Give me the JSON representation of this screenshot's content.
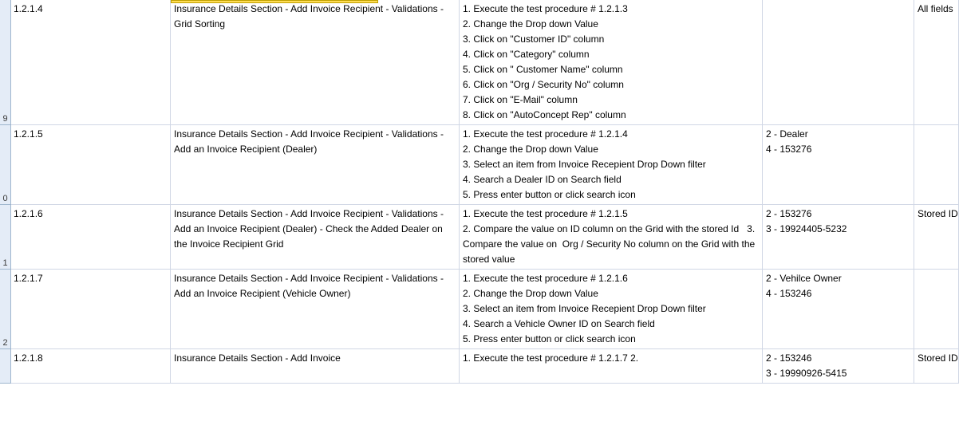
{
  "row_headers": [
    "9",
    "0",
    "1",
    "2",
    ""
  ],
  "rows": [
    {
      "id": "1.2.1.4",
      "title": "Insurance Details Section - Add Invoice Recipient - Validations - Grid Sorting",
      "steps": "1. Execute the test procedure # 1.2.1.3\n2. Change the Drop down Value\n3. Click on \"Customer ID\" column\n4. Click on \"Category\" column\n5. Click on \" Customer Name\" column\n6. Click on \"Org / Security No\" column\n7. Click on \"E-Mail\" column\n8. Click on \"AutoConcept Rep\" column",
      "data": "",
      "note": "All fields"
    },
    {
      "id": "1.2.1.5",
      "title": "Insurance Details Section - Add Invoice Recipient - Validations - Add an Invoice Recipient (Dealer)",
      "steps": "1. Execute the test procedure # 1.2.1.4\n2. Change the Drop down Value\n3. Select an item from Invoice Recepient Drop Down filter\n4. Search a Dealer ID on Search field\n5. Press enter button or click search icon",
      "data": "2 - Dealer\n4 - 153276",
      "note": ""
    },
    {
      "id": "1.2.1.6",
      "title": "Insurance Details Section - Add Invoice Recipient - Validations - Add an Invoice Recipient (Dealer) - Check the Added Dealer on the Invoice Recipient Grid",
      "steps": "1. Execute the test procedure # 1.2.1.5\n2. Compare the value on ID column on the Grid with the stored Id   3. Compare the value on  Org / Security No column on the Grid with the stored value",
      "data": "2 - 153276\n3 - 19924405-5232",
      "note": "Stored ID\nValues on"
    },
    {
      "id": "1.2.1.7",
      "title": "Insurance Details Section - Add Invoice Recipient - Validations - Add an Invoice Recipient (Vehicle Owner)",
      "steps": "1. Execute the test procedure # 1.2.1.6\n2. Change the Drop down Value\n3. Select an item from Invoice Recepient Drop Down filter\n4. Search a Vehicle Owner ID on Search field\n5. Press enter button or click search icon",
      "data": "2 - Vehilce Owner\n4 - 153246",
      "note": ""
    },
    {
      "id": "1.2.1.8",
      "title": "Insurance Details Section - Add Invoice",
      "steps": "1. Execute the test procedure # 1.2.1.7                            2.",
      "data": "2 - 153246\n3 - 19990926-5415",
      "note": "Stored ID"
    }
  ]
}
